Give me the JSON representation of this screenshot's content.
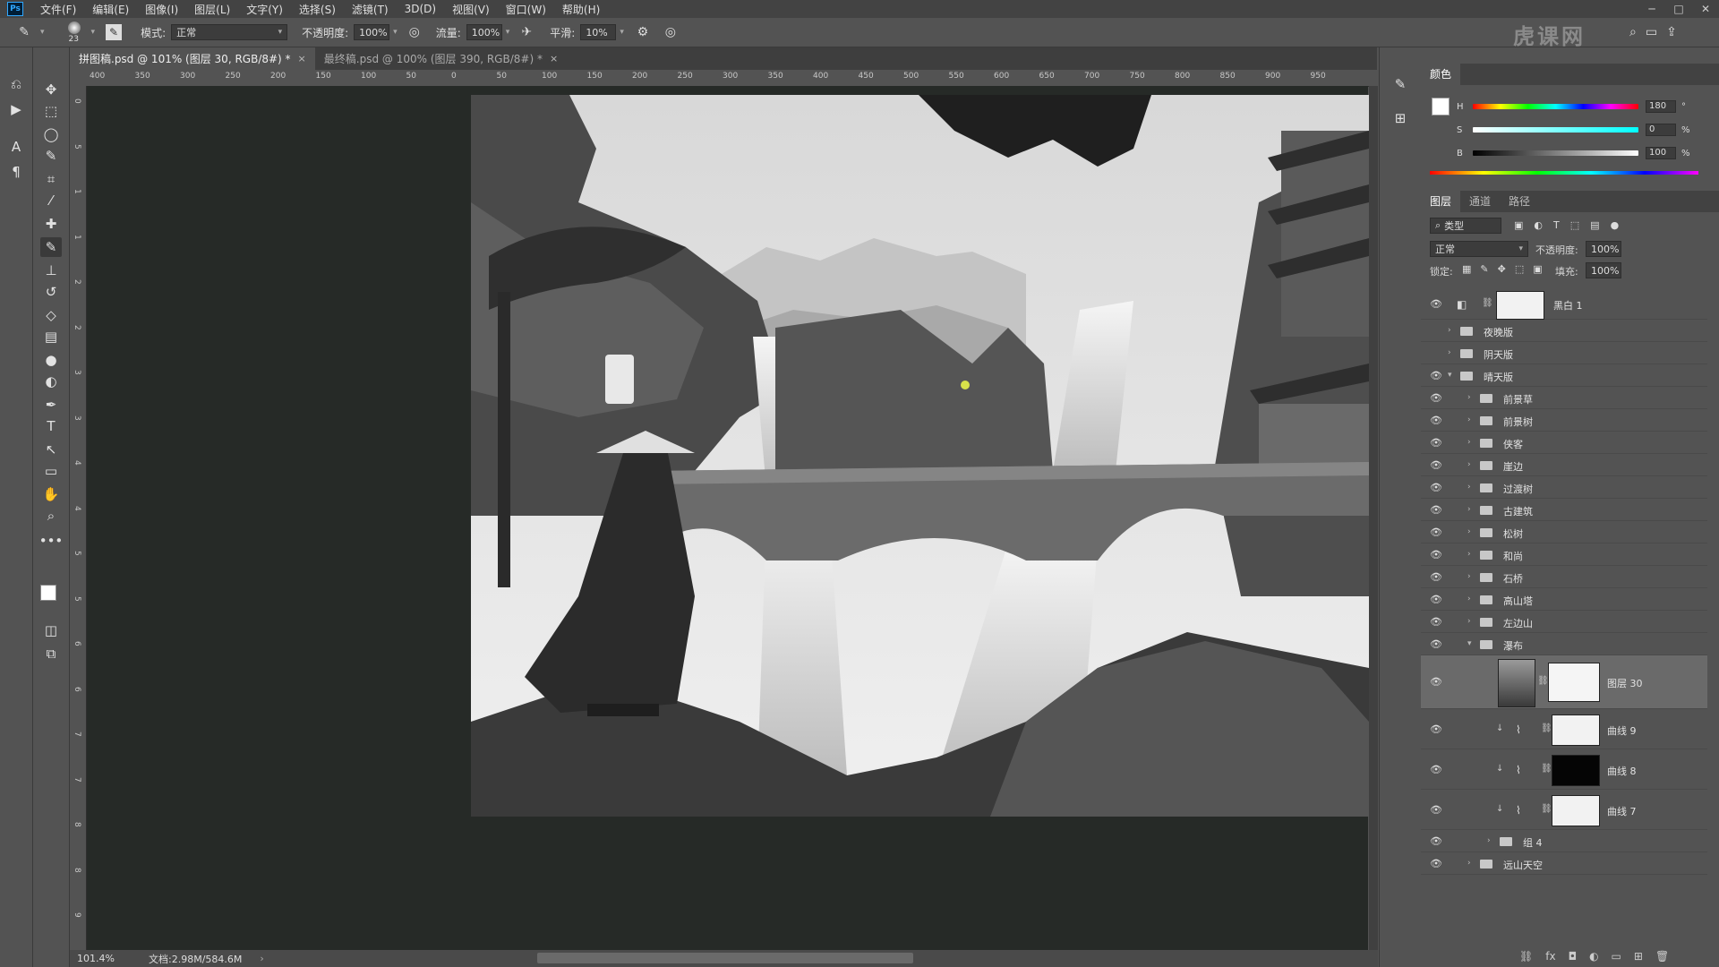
{
  "menu": [
    "文件(F)",
    "编辑(E)",
    "图像(I)",
    "图层(L)",
    "文字(Y)",
    "选择(S)",
    "滤镜(T)",
    "3D(D)",
    "视图(V)",
    "窗口(W)",
    "帮助(H)"
  ],
  "options_bar": {
    "brush_size": "23",
    "mode_label": "模式:",
    "mode_value": "正常",
    "opacity_label": "不透明度:",
    "opacity_value": "100%",
    "flow_label": "流量:",
    "flow_value": "100%",
    "smoothing_label": "平滑:",
    "smoothing_value": "10%"
  },
  "tabs": [
    {
      "label": "拼图稿.psd @ 101% (图层 30, RGB/8#) *",
      "close": "×",
      "active": true
    },
    {
      "label": "最终稿.psd @ 100% (图层 390, RGB/8#) *",
      "close": "×",
      "active": false
    }
  ],
  "ruler_top": [
    "400",
    "350",
    "300",
    "250",
    "200",
    "150",
    "100",
    "50",
    "0",
    "50",
    "100",
    "150",
    "200",
    "250",
    "300",
    "350",
    "400",
    "450",
    "500",
    "550",
    "600",
    "650",
    "700",
    "750",
    "800",
    "850",
    "900",
    "950"
  ],
  "ruler_left": [
    "0",
    "5",
    "1",
    "1",
    "2",
    "2",
    "3",
    "3",
    "4",
    "4",
    "5",
    "5",
    "6",
    "6",
    "7",
    "7",
    "8",
    "8",
    "9"
  ],
  "status": {
    "zoom": "101.4%",
    "doc": "文档:2.98M/584.6M"
  },
  "color_panel": {
    "title": "颜色",
    "h_label": "H",
    "h_value": "180",
    "h_unit": "°",
    "s_label": "S",
    "s_value": "0",
    "s_unit": "%",
    "b_label": "B",
    "b_value": "100",
    "b_unit": "%"
  },
  "layers_panel": {
    "tabs": [
      "图层",
      "通道",
      "路径"
    ],
    "filter_label": "类型",
    "blend_mode": "正常",
    "opacity_label": "不透明度:",
    "opacity_value": "100%",
    "lock_label": "锁定:",
    "fill_label": "填充:",
    "fill_value": "100%",
    "layers": [
      {
        "name": "黑白 1",
        "eye": true,
        "indent": 0,
        "type": "adjustment"
      },
      {
        "name": "夜晚版",
        "eye": false,
        "indent": 0,
        "type": "group"
      },
      {
        "name": "阴天版",
        "eye": false,
        "indent": 0,
        "type": "group"
      },
      {
        "name": "晴天版",
        "eye": true,
        "indent": 0,
        "type": "group-open"
      },
      {
        "name": "前景草",
        "eye": true,
        "indent": 1,
        "type": "group"
      },
      {
        "name": "前景树",
        "eye": true,
        "indent": 1,
        "type": "group"
      },
      {
        "name": "侠客",
        "eye": true,
        "indent": 1,
        "type": "group"
      },
      {
        "name": "崖边",
        "eye": true,
        "indent": 1,
        "type": "group"
      },
      {
        "name": "过渡树",
        "eye": true,
        "indent": 1,
        "type": "group"
      },
      {
        "name": "古建筑",
        "eye": true,
        "indent": 1,
        "type": "group"
      },
      {
        "name": "松树",
        "eye": true,
        "indent": 1,
        "type": "group"
      },
      {
        "name": "和尚",
        "eye": true,
        "indent": 1,
        "type": "group"
      },
      {
        "name": "石桥",
        "eye": true,
        "indent": 1,
        "type": "group"
      },
      {
        "name": "高山塔",
        "eye": true,
        "indent": 1,
        "type": "group"
      },
      {
        "name": "左边山",
        "eye": true,
        "indent": 1,
        "type": "group"
      },
      {
        "name": "瀑布",
        "eye": true,
        "indent": 1,
        "type": "group-open"
      },
      {
        "name": "图层 30",
        "eye": true,
        "indent": 2,
        "type": "pixel-masked"
      },
      {
        "name": "曲线 9",
        "eye": true,
        "indent": 2,
        "type": "curves"
      },
      {
        "name": "曲线 8",
        "eye": true,
        "indent": 2,
        "type": "curves-mask"
      },
      {
        "name": "曲线 7",
        "eye": true,
        "indent": 2,
        "type": "curves"
      },
      {
        "name": "组 4",
        "eye": true,
        "indent": 2,
        "type": "group"
      },
      {
        "name": "远山天空",
        "eye": true,
        "indent": 1,
        "type": "group"
      }
    ]
  },
  "watermark": "虎课网"
}
